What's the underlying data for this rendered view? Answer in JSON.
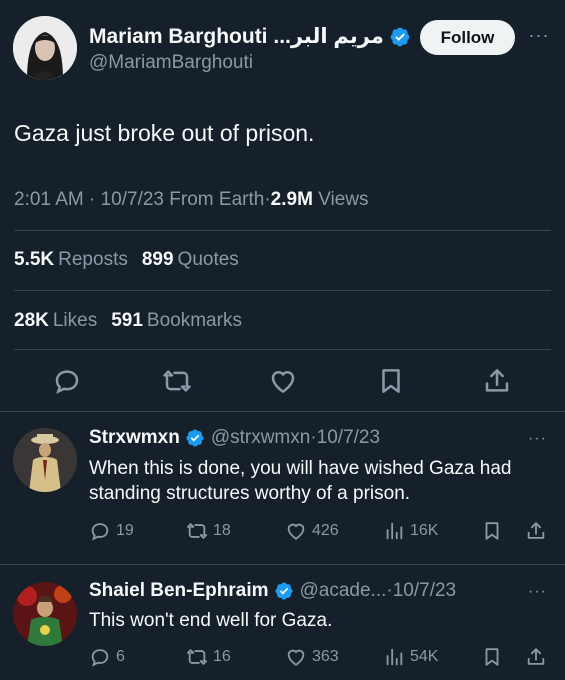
{
  "main_tweet": {
    "display_name": "Mariam Barghouti ...مريم البر",
    "handle": "@MariamBarghouti",
    "follow_label": "Follow",
    "text": "Gaza just broke out of prison.",
    "time": "2:01 AM",
    "date": "10/7/23",
    "source": "From Earth",
    "views_count": "2.9M",
    "views_label": "Views",
    "reposts_count": "5.5K",
    "reposts_label": "Reposts",
    "quotes_count": "899",
    "quotes_label": "Quotes",
    "likes_count": "28K",
    "likes_label": "Likes",
    "bookmarks_count": "591",
    "bookmarks_label": "Bookmarks"
  },
  "replies": [
    {
      "display_name": "Strxwmxn",
      "handle": "@strxwmxn",
      "date": "10/7/23",
      "text": "When this is done, you will have wished Gaza had standing structures worthy of a prison.",
      "replies": "19",
      "reposts": "18",
      "likes": "426",
      "views": "16K"
    },
    {
      "display_name": "Shaiel Ben-Ephraim",
      "handle": "@acade...",
      "date": "10/7/23",
      "text": "This won't end well for Gaza.",
      "replies": "6",
      "reposts": "16",
      "likes": "363",
      "views": "54K"
    }
  ],
  "colors": {
    "background": "#15202b",
    "verified": "#1d9bf0",
    "muted": "#8b98a5",
    "divider": "#38444d"
  },
  "separators": {
    "dot": "·",
    "more": "···"
  }
}
